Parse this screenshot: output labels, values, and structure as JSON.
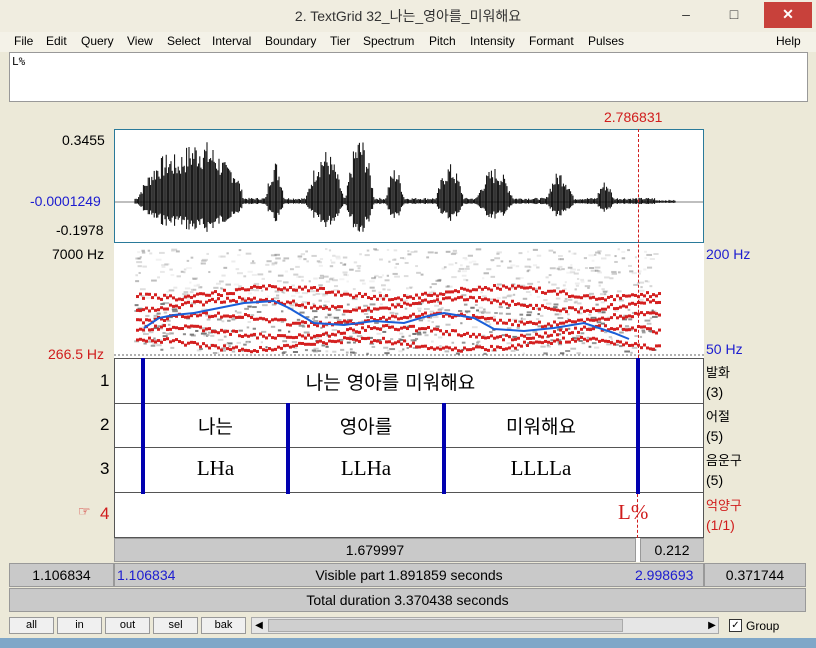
{
  "window": {
    "title": "2. TextGrid 32_나는_영아를_미워해요",
    "minimize": "–",
    "maximize": "□",
    "close": "✕"
  },
  "menu": [
    "File",
    "Edit",
    "Query",
    "View",
    "Select",
    "Interval",
    "Boundary",
    "Tier",
    "Spectrum",
    "Pitch",
    "Intensity",
    "Formant",
    "Pulses",
    "Help"
  ],
  "text_field": {
    "value": "L%"
  },
  "cursor_time": "2.786831",
  "waveform": {
    "max": "0.3455",
    "mid": "-0.0001249",
    "min": "-0.1978"
  },
  "spectrogram": {
    "top_freq": "7000 Hz",
    "cursor_freq": "266.5 Hz",
    "pitch_top": "200 Hz",
    "pitch_bottom": "50 Hz"
  },
  "tiers": [
    {
      "number": "1",
      "name": "발화",
      "count": "(3)",
      "intervals": [
        "나는 영아를 미워해요"
      ]
    },
    {
      "number": "2",
      "name": "어절",
      "count": "(5)",
      "intervals": [
        "나는",
        "영아를",
        "미워해요"
      ]
    },
    {
      "number": "3",
      "name": "음운구",
      "count": "(5)",
      "intervals": [
        "LHa",
        "LLHa",
        "LLLLa"
      ]
    },
    {
      "number": "4",
      "name": "억양구",
      "count": "(1/1)",
      "selected_marker": "☞",
      "points": [
        "L%"
      ]
    }
  ],
  "segments": {
    "selected_duration": "1.679997",
    "right_duration": "0.212"
  },
  "visible": {
    "left_outside": "1.106834",
    "start": "1.106834",
    "label": "Visible part 1.891859 seconds",
    "end": "2.998693",
    "right_outside": "0.371744"
  },
  "total": {
    "label": "Total duration 3.370438 seconds"
  },
  "buttons": [
    "all",
    "in",
    "out",
    "sel",
    "bak"
  ],
  "group": {
    "label": "Group",
    "checked": true
  },
  "colors": {
    "pitch": "#1a5fd8",
    "formant": "#d42020",
    "boundary": "#0000b0",
    "cursor": "#d01c1c"
  }
}
